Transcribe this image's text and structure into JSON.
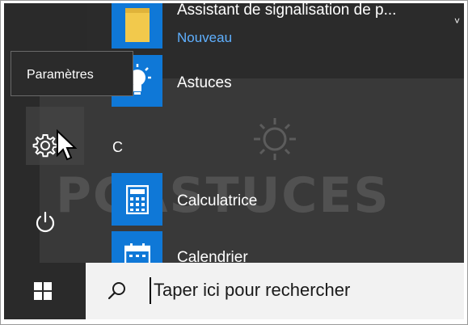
{
  "start_menu": {
    "apps": [
      {
        "name": "Assistant de signalisation de p...",
        "sub": "Nouveau"
      },
      {
        "name": "Astuces"
      },
      {
        "name": "Calculatrice"
      },
      {
        "name": "Calendrier"
      }
    ],
    "section_letter": "C",
    "more_chevron": "˅",
    "tooltip": "Paramètres",
    "watermark": "PCASTUCES"
  },
  "taskbar": {
    "search_placeholder": "Taper ici pour rechercher"
  },
  "colors": {
    "tile_blue": "#0f78d7",
    "accent_link": "#5fb0ff",
    "menu_bg": "#2b2b2b",
    "search_bg": "#f2f2f2"
  }
}
